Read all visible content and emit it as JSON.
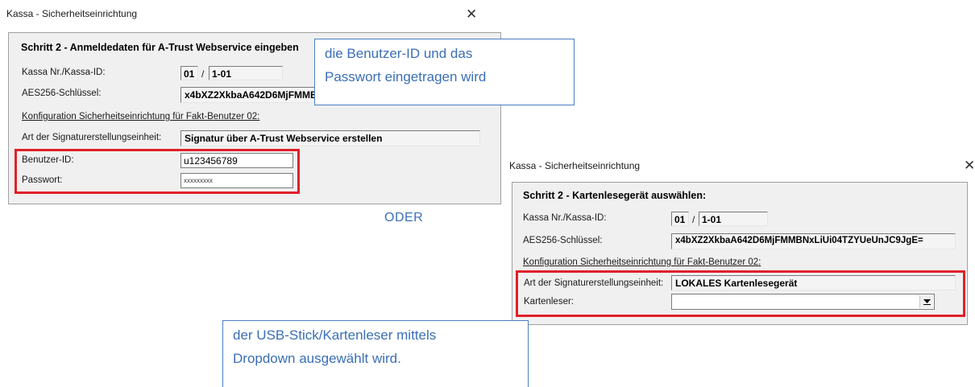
{
  "window1": {
    "title": "Kassa - Sicherheitseinrichtung",
    "close": "✕",
    "heading": "Schritt 2 - Anmeldedaten für A-Trust Webservice eingeben",
    "kassa_label": "Kassa Nr./Kassa-ID:",
    "kassa_nr": "01",
    "kassa_sep": "/",
    "kassa_id": "1-01",
    "aes_label": "AES256-Schlüssel:",
    "aes_value": "x4bXZ2XkbaA642D6MjFMMBNxLiUi04TZYUeUnJC9JgE=",
    "config_label": "Konfiguration Sicherheitseinrichtung für Fakt-Benutzer 02:",
    "sig_label": "Art der Signaturerstellungseinheit:",
    "sig_value": "Signatur über A-Trust Webservice erstellen",
    "user_label": "Benutzer-ID:",
    "user_value": "u123456789",
    "pw_label": "Passwort:",
    "pw_value": "xxxxxxxxx"
  },
  "window2": {
    "title": "Kassa - Sicherheitseinrichtung",
    "close": "✕",
    "heading": "Schritt 2 - Kartenlesegerät auswählen:",
    "kassa_label": "Kassa Nr./Kassa-ID:",
    "kassa_nr": "01",
    "kassa_sep": "/",
    "kassa_id": "1-01",
    "aes_label": "AES256-Schlüssel:",
    "aes_value": "x4bXZ2XkbaA642D6MjFMMBNxLiUi04TZYUeUnJC9JgE=",
    "config_label": "Konfiguration Sicherheitseinrichtung für Fakt-Benutzer 02:",
    "sig_label": "Art der Signaturerstellungseinheit:",
    "sig_value": "LOKALES Kartenlesegerät",
    "reader_label": "Kartenleser:",
    "reader_value": ""
  },
  "callout_top": {
    "line1": "die Benutzer-ID und das",
    "line2": "Passwort eingetragen wird"
  },
  "separator_text": "ODER",
  "callout_bottom": {
    "line1": "der USB-Stick/Kartenleser mittels",
    "line2": "Dropdown ausgewählt wird."
  },
  "colors": {
    "highlight": "#e0202a",
    "callout_text": "#3a6fb5",
    "callout_border": "#4a7fc1",
    "dialog_bg": "#f0f0f0"
  },
  "icons": {
    "close": "close-icon",
    "dropdown": "chevron-down-icon"
  }
}
